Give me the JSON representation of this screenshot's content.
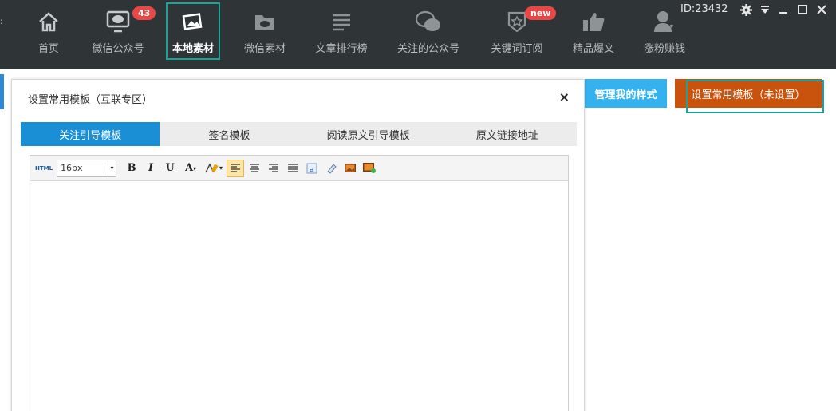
{
  "nav": {
    "items": [
      {
        "label": "首页",
        "icon": "home-icon"
      },
      {
        "label": "微信公众号",
        "icon": "monitor-wechat-icon",
        "badge": "43"
      },
      {
        "label": "本地素材",
        "icon": "images-icon",
        "active": true
      },
      {
        "label": "微信素材",
        "icon": "wechat-folder-icon"
      },
      {
        "label": "文章排行榜",
        "icon": "list-lines-icon"
      },
      {
        "label": "关注的公众号",
        "icon": "wechat-bubbles-icon"
      },
      {
        "label": "关键词订阅",
        "icon": "star-shield-icon",
        "badge": "new"
      },
      {
        "label": "精品爆文",
        "icon": "thumbs-up-icon"
      },
      {
        "label": "涨粉赚钱",
        "icon": "user-heart-icon"
      }
    ]
  },
  "window": {
    "id_text": "ID:23432"
  },
  "actions": {
    "manage_label": "管理我的样式",
    "setting_label": "设置常用模板（未设置）"
  },
  "dialog": {
    "title": "设置常用模板（互联专区）",
    "close": "×",
    "tabs": [
      "关注引导模板",
      "签名模板",
      "阅读原文引导模板",
      "原文链接地址"
    ]
  },
  "editor": {
    "html_label": "HTML",
    "font_size": "16px"
  },
  "colors": {
    "topbar": "#2f3437",
    "accent_teal": "#1aa39a",
    "tab_active": "#1a8fd6",
    "manage_button": "#34b1ef",
    "setting_button": "#c9520c",
    "badge": "#e94646"
  }
}
